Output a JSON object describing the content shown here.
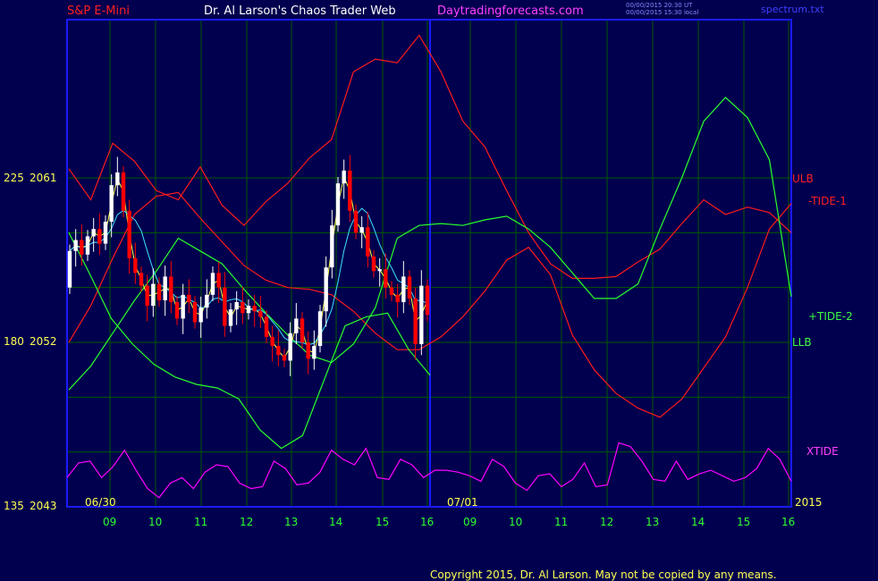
{
  "header": {
    "symbol": "S&P E-Mini",
    "site_title": "Dr. Al Larson's Chaos Trader Web",
    "url": "Daytradingforecasts.com",
    "time_ut": "00/00/2015 20:30 UT",
    "time_local": "00/00/2015 15:30 local",
    "file": "spectrum.txt"
  },
  "footer": {
    "copyright": "Copyright 2015, Dr. Al Larson. May not be copied by any means."
  },
  "colors": {
    "background": "#00004e",
    "frame": "#1a1aff",
    "grid": "#005a00",
    "price_up": "#ffffff",
    "price_down": "#ff0000",
    "ulb": "#ff1a1a",
    "tide_minus": "#ff1a1a",
    "llb": "#2aff2a",
    "tide_plus": "#2aff2a",
    "xtide": "#ff00ff",
    "ma_yellow": "#ffff40",
    "ma_cyan": "#40e0ff"
  },
  "chart_data": {
    "type": "line",
    "title": "S&P E-Mini",
    "y_ticks": [
      {
        "left": "225",
        "right": "2061"
      },
      {
        "left": "180",
        "right": "2052"
      },
      {
        "left": "135",
        "right": "2043"
      }
    ],
    "x_ticks": [
      "09",
      "10",
      "11",
      "12",
      "13",
      "14",
      "15",
      "16",
      "09",
      "10",
      "11",
      "12",
      "13",
      "14",
      "15",
      "16"
    ],
    "date_labels": [
      "06/30",
      "07/01",
      "2015"
    ],
    "series_labels": {
      "ulb": "ULB",
      "tide_minus": "-TIDE-1",
      "tide_plus": "+TIDE-2",
      "llb": "LLB",
      "xtide": "XTIDE"
    },
    "price_closes": [
      2057.0,
      2057.6,
      2056.8,
      2057.8,
      2058.2,
      2057.4,
      2058.6,
      2060.6,
      2061.3,
      2059.2,
      2056.6,
      2055.8,
      2055.1,
      2054.0,
      2055.2,
      2054.3,
      2055.6,
      2054.2,
      2053.3,
      2054.6,
      2054.2,
      2053.1,
      2053.9,
      2054.6,
      2055.8,
      2055.0,
      2052.9,
      2053.8,
      2054.2,
      2053.6,
      2054.0,
      2053.7,
      2053.4,
      2052.3,
      2051.8,
      2051.3,
      2051.0,
      2052.5,
      2053.3,
      2052.0,
      2051.1,
      2051.8,
      2053.7,
      2056.1,
      2058.4,
      2060.7,
      2061.4,
      2059.2,
      2058.0,
      2058.3,
      2056.7,
      2055.9,
      2056.0,
      2055.0,
      2054.6,
      2054.2,
      2055.6,
      2054.4,
      2051.9,
      2055.1,
      2053.5
    ],
    "price_range_opens": [
      2055.0,
      2059.0
    ],
    "ulb": [
      2061.5,
      2059.8,
      2062.9,
      2061.9,
      2060.3,
      2059.8,
      2061.6,
      2059.5,
      2058.4,
      2059.7,
      2060.7,
      2062.1,
      2063.1,
      2066.8,
      2067.5,
      2067.3,
      2068.8,
      2066.8,
      2064.1,
      2062.7,
      2060.3,
      2058.0,
      2056.3,
      2055.5,
      2055.5,
      2055.6,
      2056.4,
      2057.1,
      2058.5,
      2059.8,
      2059.0,
      2059.4,
      2059.1,
      2058.0
    ],
    "tide_minus": [
      2052.0,
      2054.0,
      2056.6,
      2059.0,
      2060.0,
      2060.2,
      2058.8,
      2057.5,
      2056.2,
      2055.4,
      2055.0,
      2054.9,
      2054.6,
      2053.7,
      2052.5,
      2051.6,
      2051.6,
      2052.3,
      2053.4,
      2054.8,
      2056.5,
      2057.2,
      2055.7,
      2052.4,
      2050.5,
      2049.2,
      2048.4,
      2047.9,
      2048.9,
      2050.6,
      2052.3,
      2055.0,
      2058.2,
      2059.6
    ],
    "tide_plus": [
      2049.4,
      2050.7,
      2052.5,
      2054.3,
      2055.9,
      2057.7,
      2057.0,
      2056.3,
      2054.9,
      2053.6,
      2052.4,
      2051.3,
      2050.9,
      2051.9,
      2053.9,
      2057.7,
      2058.4,
      2058.5,
      2058.4,
      2058.7,
      2058.9,
      2058.2,
      2057.2,
      2055.8,
      2054.4,
      2054.4,
      2055.2,
      2058.2,
      2061.0,
      2064.1,
      2065.4,
      2064.3,
      2062.0,
      2054.5
    ],
    "llb": [
      2058.0,
      2055.7,
      2053.3,
      2051.9,
      2050.8,
      2050.1,
      2049.7,
      2049.5,
      2048.9,
      2047.2,
      2046.2,
      2046.9,
      2049.9,
      2052.9,
      2053.4,
      2053.6,
      2051.6,
      2050.2
    ],
    "xtide": [
      2044.6,
      2045.4,
      2045.5,
      2044.6,
      2045.2,
      2046.1,
      2045.0,
      2044.0,
      2043.5,
      2044.3,
      2044.6,
      2044.0,
      2044.9,
      2045.3,
      2045.2,
      2044.3,
      2044.0,
      2044.1,
      2045.5,
      2045.1,
      2044.2,
      2044.3,
      2044.9,
      2046.1,
      2045.6,
      2045.3,
      2046.2,
      2044.6,
      2044.5,
      2045.6,
      2045.3,
      2044.6,
      2045.0,
      2045.0,
      2044.9,
      2044.7,
      2044.4,
      2045.6,
      2045.2,
      2044.3,
      2043.9,
      2044.7,
      2044.8,
      2044.1,
      2044.5,
      2045.4,
      2044.1,
      2044.2,
      2046.5,
      2046.3,
      2045.5,
      2044.5,
      2044.4,
      2045.5,
      2044.5,
      2044.8,
      2045.0,
      2044.7,
      2044.4,
      2044.6,
      2045.1,
      2046.2,
      2045.6,
      2044.4
    ]
  }
}
